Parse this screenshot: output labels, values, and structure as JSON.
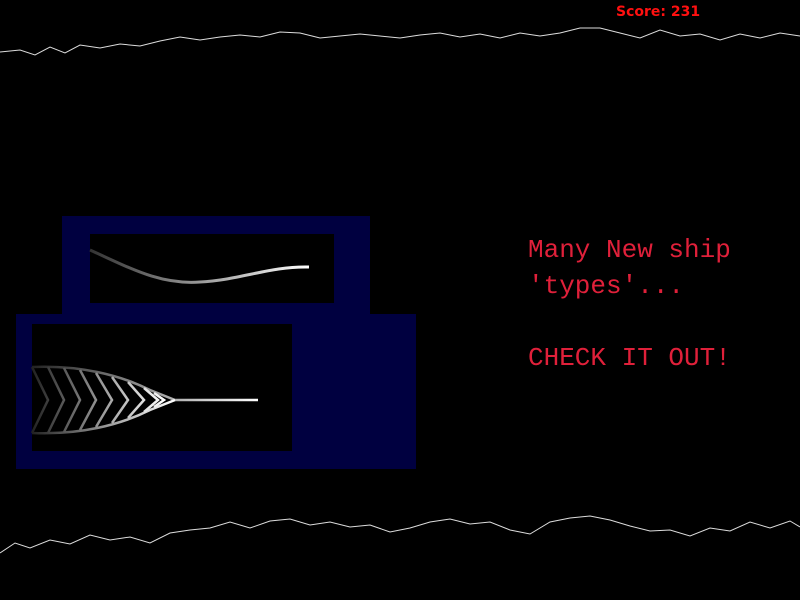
{
  "hud": {
    "score_label": "Score: 231"
  },
  "message": {
    "line1": "Many New ship",
    "line2": "'types'...",
    "line3": "CHECK IT OUT!"
  },
  "colors": {
    "score": "#ff1010",
    "message": "#e0203a",
    "panel": "#000040",
    "cave": "#ffffff"
  }
}
